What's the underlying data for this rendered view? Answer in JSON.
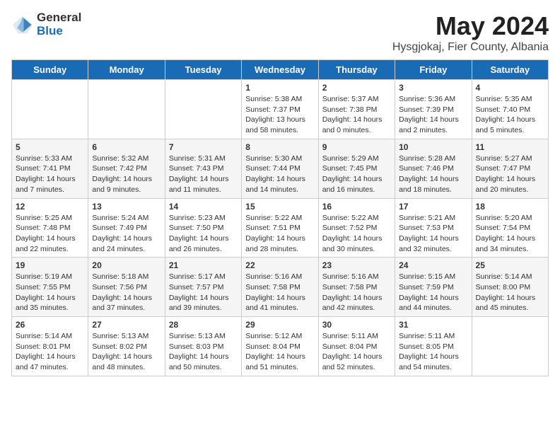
{
  "header": {
    "logo": {
      "general": "General",
      "blue": "Blue"
    },
    "title": "May 2024",
    "subtitle": "Hysgjokaj, Fier County, Albania"
  },
  "days_of_week": [
    "Sunday",
    "Monday",
    "Tuesday",
    "Wednesday",
    "Thursday",
    "Friday",
    "Saturday"
  ],
  "weeks": [
    [
      {
        "day": "",
        "sunrise": "",
        "sunset": "",
        "daylight": ""
      },
      {
        "day": "",
        "sunrise": "",
        "sunset": "",
        "daylight": ""
      },
      {
        "day": "",
        "sunrise": "",
        "sunset": "",
        "daylight": ""
      },
      {
        "day": "1",
        "sunrise": "Sunrise: 5:38 AM",
        "sunset": "Sunset: 7:37 PM",
        "daylight": "Daylight: 13 hours and 58 minutes."
      },
      {
        "day": "2",
        "sunrise": "Sunrise: 5:37 AM",
        "sunset": "Sunset: 7:38 PM",
        "daylight": "Daylight: 14 hours and 0 minutes."
      },
      {
        "day": "3",
        "sunrise": "Sunrise: 5:36 AM",
        "sunset": "Sunset: 7:39 PM",
        "daylight": "Daylight: 14 hours and 2 minutes."
      },
      {
        "day": "4",
        "sunrise": "Sunrise: 5:35 AM",
        "sunset": "Sunset: 7:40 PM",
        "daylight": "Daylight: 14 hours and 5 minutes."
      }
    ],
    [
      {
        "day": "5",
        "sunrise": "Sunrise: 5:33 AM",
        "sunset": "Sunset: 7:41 PM",
        "daylight": "Daylight: 14 hours and 7 minutes."
      },
      {
        "day": "6",
        "sunrise": "Sunrise: 5:32 AM",
        "sunset": "Sunset: 7:42 PM",
        "daylight": "Daylight: 14 hours and 9 minutes."
      },
      {
        "day": "7",
        "sunrise": "Sunrise: 5:31 AM",
        "sunset": "Sunset: 7:43 PM",
        "daylight": "Daylight: 14 hours and 11 minutes."
      },
      {
        "day": "8",
        "sunrise": "Sunrise: 5:30 AM",
        "sunset": "Sunset: 7:44 PM",
        "daylight": "Daylight: 14 hours and 14 minutes."
      },
      {
        "day": "9",
        "sunrise": "Sunrise: 5:29 AM",
        "sunset": "Sunset: 7:45 PM",
        "daylight": "Daylight: 14 hours and 16 minutes."
      },
      {
        "day": "10",
        "sunrise": "Sunrise: 5:28 AM",
        "sunset": "Sunset: 7:46 PM",
        "daylight": "Daylight: 14 hours and 18 minutes."
      },
      {
        "day": "11",
        "sunrise": "Sunrise: 5:27 AM",
        "sunset": "Sunset: 7:47 PM",
        "daylight": "Daylight: 14 hours and 20 minutes."
      }
    ],
    [
      {
        "day": "12",
        "sunrise": "Sunrise: 5:25 AM",
        "sunset": "Sunset: 7:48 PM",
        "daylight": "Daylight: 14 hours and 22 minutes."
      },
      {
        "day": "13",
        "sunrise": "Sunrise: 5:24 AM",
        "sunset": "Sunset: 7:49 PM",
        "daylight": "Daylight: 14 hours and 24 minutes."
      },
      {
        "day": "14",
        "sunrise": "Sunrise: 5:23 AM",
        "sunset": "Sunset: 7:50 PM",
        "daylight": "Daylight: 14 hours and 26 minutes."
      },
      {
        "day": "15",
        "sunrise": "Sunrise: 5:22 AM",
        "sunset": "Sunset: 7:51 PM",
        "daylight": "Daylight: 14 hours and 28 minutes."
      },
      {
        "day": "16",
        "sunrise": "Sunrise: 5:22 AM",
        "sunset": "Sunset: 7:52 PM",
        "daylight": "Daylight: 14 hours and 30 minutes."
      },
      {
        "day": "17",
        "sunrise": "Sunrise: 5:21 AM",
        "sunset": "Sunset: 7:53 PM",
        "daylight": "Daylight: 14 hours and 32 minutes."
      },
      {
        "day": "18",
        "sunrise": "Sunrise: 5:20 AM",
        "sunset": "Sunset: 7:54 PM",
        "daylight": "Daylight: 14 hours and 34 minutes."
      }
    ],
    [
      {
        "day": "19",
        "sunrise": "Sunrise: 5:19 AM",
        "sunset": "Sunset: 7:55 PM",
        "daylight": "Daylight: 14 hours and 35 minutes."
      },
      {
        "day": "20",
        "sunrise": "Sunrise: 5:18 AM",
        "sunset": "Sunset: 7:56 PM",
        "daylight": "Daylight: 14 hours and 37 minutes."
      },
      {
        "day": "21",
        "sunrise": "Sunrise: 5:17 AM",
        "sunset": "Sunset: 7:57 PM",
        "daylight": "Daylight: 14 hours and 39 minutes."
      },
      {
        "day": "22",
        "sunrise": "Sunrise: 5:16 AM",
        "sunset": "Sunset: 7:58 PM",
        "daylight": "Daylight: 14 hours and 41 minutes."
      },
      {
        "day": "23",
        "sunrise": "Sunrise: 5:16 AM",
        "sunset": "Sunset: 7:58 PM",
        "daylight": "Daylight: 14 hours and 42 minutes."
      },
      {
        "day": "24",
        "sunrise": "Sunrise: 5:15 AM",
        "sunset": "Sunset: 7:59 PM",
        "daylight": "Daylight: 14 hours and 44 minutes."
      },
      {
        "day": "25",
        "sunrise": "Sunrise: 5:14 AM",
        "sunset": "Sunset: 8:00 PM",
        "daylight": "Daylight: 14 hours and 45 minutes."
      }
    ],
    [
      {
        "day": "26",
        "sunrise": "Sunrise: 5:14 AM",
        "sunset": "Sunset: 8:01 PM",
        "daylight": "Daylight: 14 hours and 47 minutes."
      },
      {
        "day": "27",
        "sunrise": "Sunrise: 5:13 AM",
        "sunset": "Sunset: 8:02 PM",
        "daylight": "Daylight: 14 hours and 48 minutes."
      },
      {
        "day": "28",
        "sunrise": "Sunrise: 5:13 AM",
        "sunset": "Sunset: 8:03 PM",
        "daylight": "Daylight: 14 hours and 50 minutes."
      },
      {
        "day": "29",
        "sunrise": "Sunrise: 5:12 AM",
        "sunset": "Sunset: 8:04 PM",
        "daylight": "Daylight: 14 hours and 51 minutes."
      },
      {
        "day": "30",
        "sunrise": "Sunrise: 5:11 AM",
        "sunset": "Sunset: 8:04 PM",
        "daylight": "Daylight: 14 hours and 52 minutes."
      },
      {
        "day": "31",
        "sunrise": "Sunrise: 5:11 AM",
        "sunset": "Sunset: 8:05 PM",
        "daylight": "Daylight: 14 hours and 54 minutes."
      },
      {
        "day": "",
        "sunrise": "",
        "sunset": "",
        "daylight": ""
      }
    ]
  ]
}
